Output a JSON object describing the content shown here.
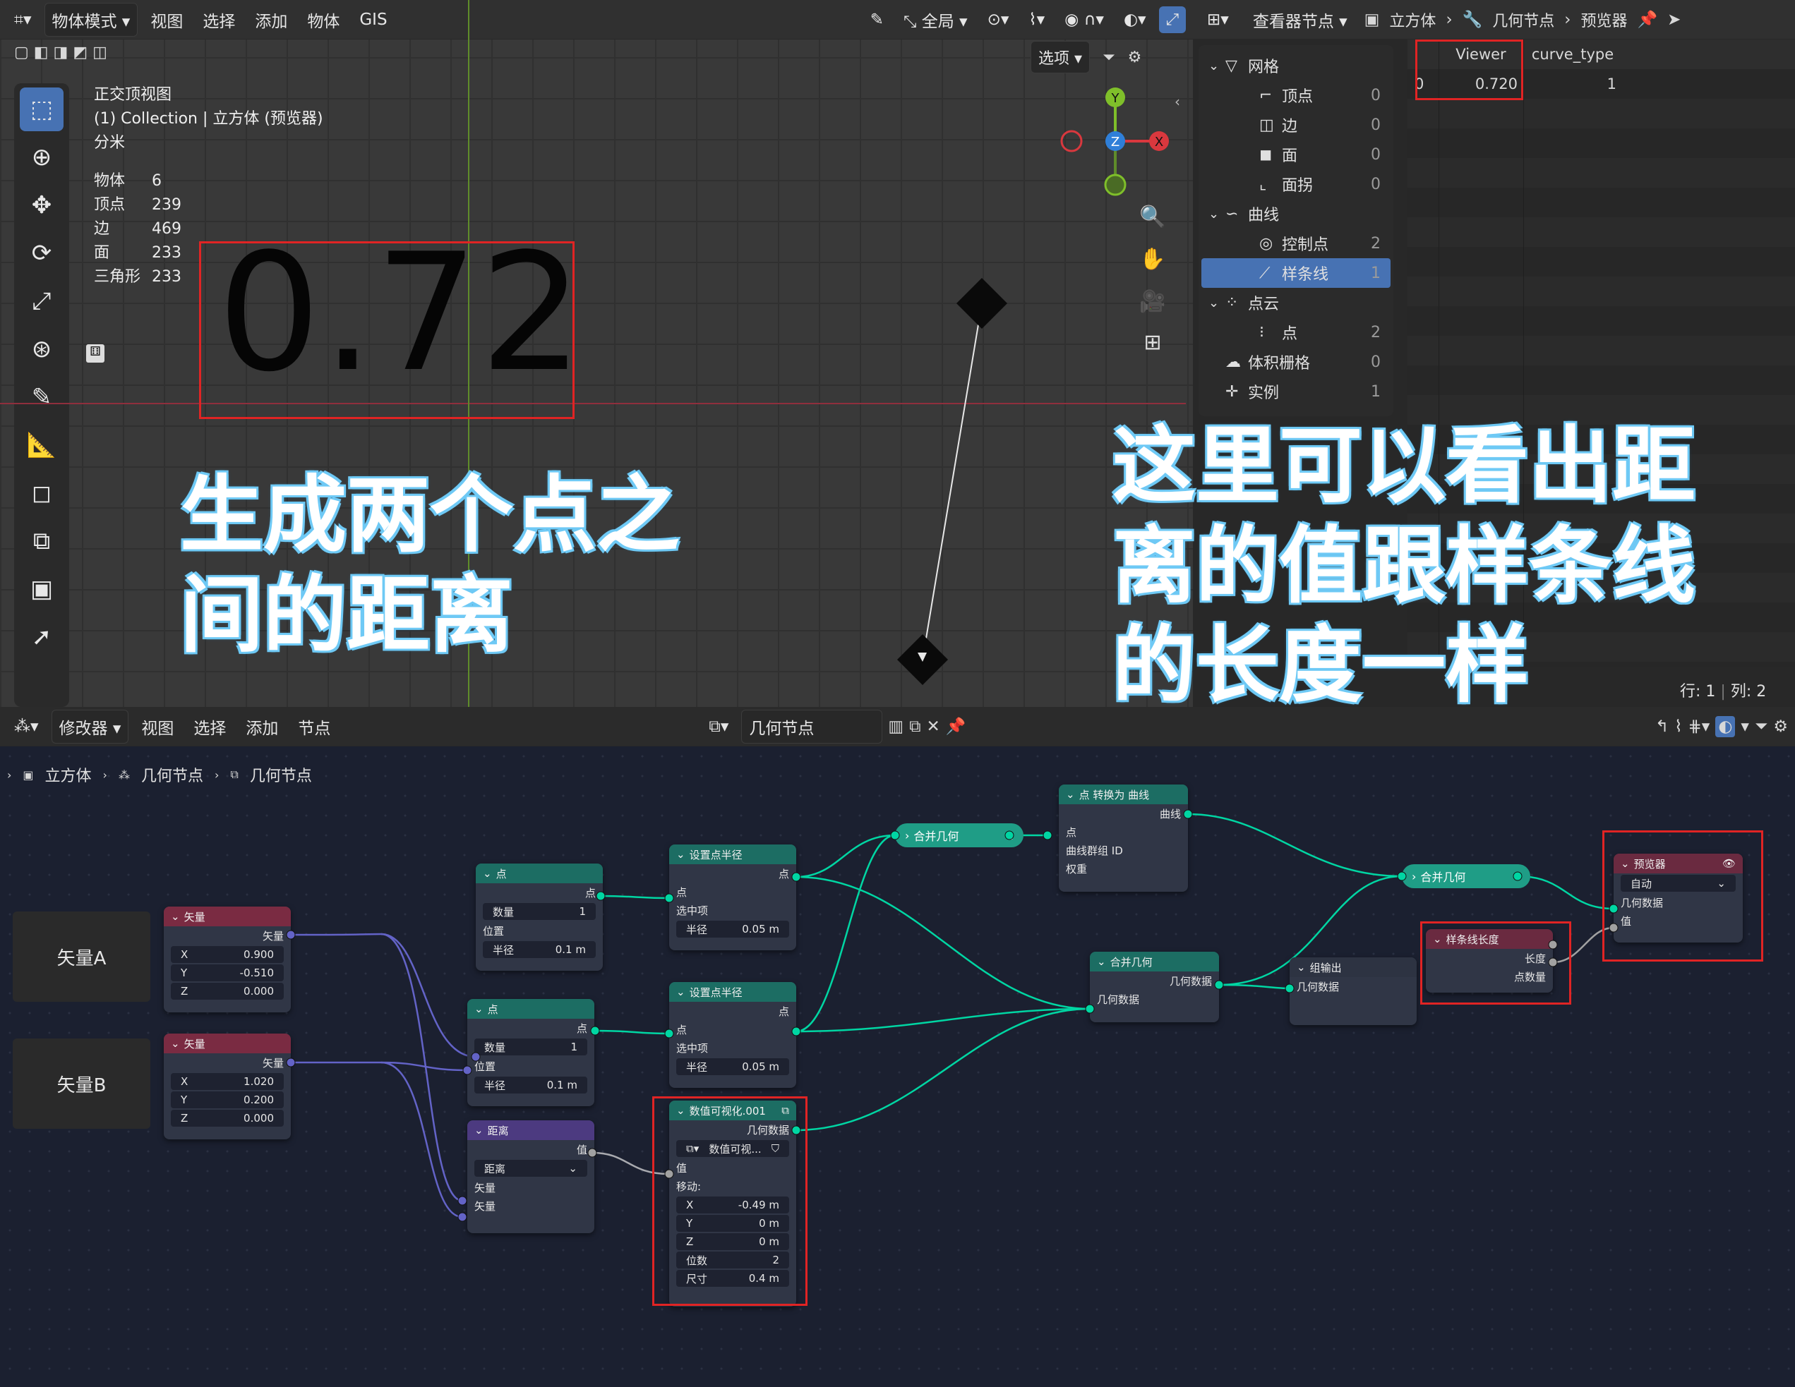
{
  "viewport": {
    "header": {
      "editor_icon": "grid-icon",
      "mode": "物体模式",
      "menu": [
        "视图",
        "选择",
        "添加",
        "物体",
        "GIS"
      ],
      "transform_label": "全局",
      "options_label": "选项"
    },
    "info": {
      "line1": "正交顶视图",
      "line2": "(1) Collection | 立方体 (预览器)",
      "line3": "分米"
    },
    "stats": [
      {
        "k": "物体",
        "v": "6"
      },
      {
        "k": "顶点",
        "v": "239"
      },
      {
        "k": "边",
        "v": "469"
      },
      {
        "k": "面",
        "v": "233"
      },
      {
        "k": "三角形",
        "v": "233"
      }
    ],
    "big_value": "0.72",
    "gizmo": {
      "x": "X",
      "y": "Y",
      "z": "Z"
    }
  },
  "callouts": {
    "left": [
      "生成两个点之",
      "间的距离"
    ],
    "right": [
      "这里可以看出距",
      "离的值跟样条线",
      "的长度一样"
    ]
  },
  "outliner": {
    "header": {
      "editor": "查看器节点",
      "crumbs": [
        "立方体",
        "几何节点",
        "预览器"
      ]
    },
    "tree": [
      {
        "label": "网格",
        "count": "",
        "level": 0,
        "icon": "mesh-icon"
      },
      {
        "label": "顶点",
        "count": "0",
        "level": 1,
        "icon": "vertex-icon"
      },
      {
        "label": "边",
        "count": "0",
        "level": 1,
        "icon": "edge-icon"
      },
      {
        "label": "面",
        "count": "0",
        "level": 1,
        "icon": "face-icon"
      },
      {
        "label": "面拐",
        "count": "0",
        "level": 1,
        "icon": "corner-icon"
      },
      {
        "label": "曲线",
        "count": "",
        "level": 0,
        "icon": "curve-icon"
      },
      {
        "label": "控制点",
        "count": "2",
        "level": 1,
        "icon": "control-point-icon"
      },
      {
        "label": "样条线",
        "count": "1",
        "level": 1,
        "icon": "spline-icon",
        "selected": true
      },
      {
        "label": "点云",
        "count": "",
        "level": 0,
        "icon": "pointcloud-icon"
      },
      {
        "label": "点",
        "count": "2",
        "level": 1,
        "icon": "point-icon"
      },
      {
        "label": "体积栅格",
        "count": "0",
        "level": 0,
        "icon": "volume-icon"
      },
      {
        "label": "实例",
        "count": "1",
        "level": 0,
        "icon": "instance-icon"
      }
    ],
    "table": {
      "cols": [
        "Viewer",
        "curve_type"
      ],
      "rows": [
        [
          "0",
          "0.720",
          "1"
        ]
      ]
    },
    "footer": {
      "rows": "行: 1",
      "cols": "列: 2"
    }
  },
  "node_editor": {
    "header": {
      "menu": [
        "修改器",
        "视图",
        "选择",
        "添加",
        "节点"
      ],
      "tree_name": "几何节点"
    },
    "crumbs": [
      "立方体",
      "几何节点",
      "几何节点"
    ],
    "frames": {
      "a": "矢量A",
      "b": "矢量B"
    },
    "vecA": {
      "title": "矢量",
      "out": "矢量",
      "x": "0.900",
      "y": "-0.510",
      "z": "0.000"
    },
    "vecB": {
      "title": "矢量",
      "out": "矢量",
      "x": "1.020",
      "y": "0.200",
      "z": "0.000"
    },
    "pt1": {
      "title": "点",
      "out": "点",
      "count_l": "数量",
      "count": "1",
      "pos": "位置",
      "rad_l": "半径",
      "rad": "0.1 m"
    },
    "pt2": {
      "title": "点",
      "out": "点",
      "count_l": "数量",
      "count": "1",
      "pos": "位置",
      "rad_l": "半径",
      "rad": "0.1 m"
    },
    "dist": {
      "title": "距离",
      "out": "值",
      "mode": "距离",
      "in1": "矢量",
      "in2": "矢量"
    },
    "spr1": {
      "title": "设置点半径",
      "out": "点",
      "in": "点",
      "sel": "选中项",
      "rad_l": "半径",
      "rad": "0.05 m"
    },
    "spr2": {
      "title": "设置点半径",
      "out": "点",
      "in": "点",
      "sel": "选中项",
      "rad_l": "半径",
      "rad": "0.05 m"
    },
    "numviz": {
      "title": "数值可视化.001",
      "out": "几何数据",
      "sub": "数值可视...",
      "val": "值",
      "move": "移动:",
      "x": "-0.49 m",
      "y": "0 m",
      "z": "0 m",
      "dig_l": "位数",
      "dig": "2",
      "size_l": "尺寸",
      "size": "0.4 m"
    },
    "join1": "合并几何",
    "join2": "合并几何",
    "p2c": {
      "title": "点 转换为 曲线",
      "out": "曲线",
      "in1": "点",
      "in2": "曲线群组 ID",
      "in3": "权重"
    },
    "joinmain": {
      "title": "合并几何",
      "out": "几何数据",
      "in": "几何数据"
    },
    "groupout": {
      "title": "组输出",
      "in": "几何数据"
    },
    "splen": {
      "title": "样条线长度",
      "out1": "长度",
      "out2": "点数量"
    },
    "viewer": {
      "title": "预览器",
      "mode": "自动",
      "in1": "几何数据",
      "in2": "值"
    }
  },
  "colors": {
    "geo": "#00d6a3",
    "vec": "#6363c7",
    "float": "#a1a1a1",
    "select": "#4772b3",
    "red": "#e02424"
  }
}
